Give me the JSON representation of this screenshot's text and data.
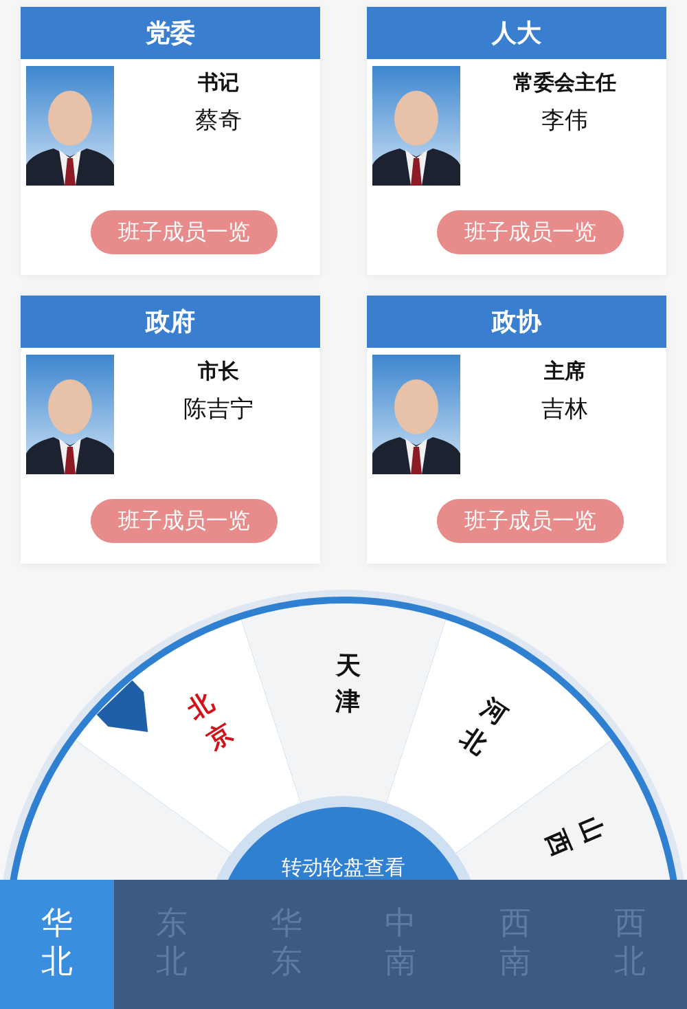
{
  "cards": [
    {
      "title": "党委",
      "role": "书记",
      "name": "蔡奇",
      "button": "班子成员一览"
    },
    {
      "title": "人大",
      "role": "常委会主任",
      "name": "李伟",
      "button": "班子成员一览"
    },
    {
      "title": "政府",
      "role": "市长",
      "name": "陈吉宁",
      "button": "班子成员一览"
    },
    {
      "title": "政协",
      "role": "主席",
      "name": "吉林",
      "button": "班子成员一览"
    }
  ],
  "wheel": {
    "hint": "转动轮盘查看",
    "cities": [
      {
        "label": "北京",
        "selected": true
      },
      {
        "label": "天津",
        "selected": false
      },
      {
        "label": "河北",
        "selected": false
      },
      {
        "label": "山西",
        "selected": false
      }
    ]
  },
  "regions": [
    {
      "label": "华北",
      "selected": true
    },
    {
      "label": "东北",
      "selected": false
    },
    {
      "label": "华东",
      "selected": false
    },
    {
      "label": "中南",
      "selected": false
    },
    {
      "label": "西南",
      "selected": false
    },
    {
      "label": "西北",
      "selected": false
    }
  ]
}
